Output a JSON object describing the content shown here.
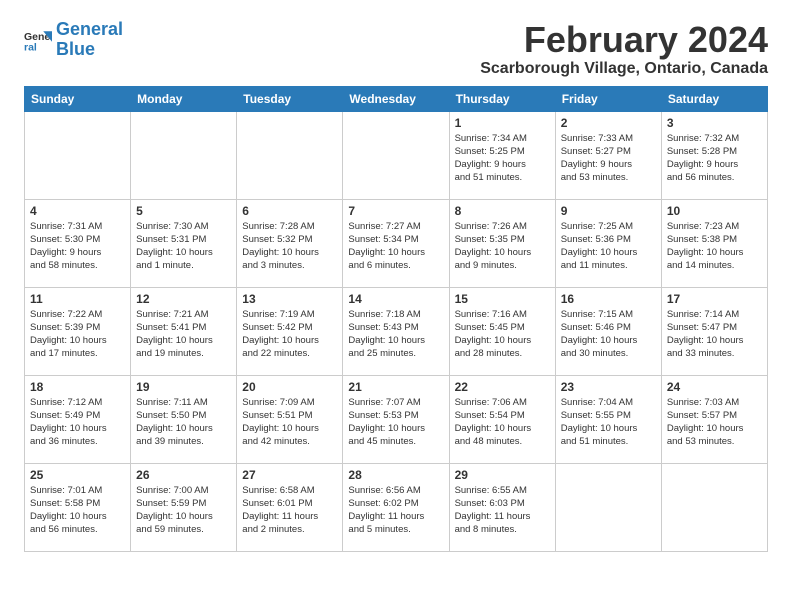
{
  "header": {
    "logo_line1": "General",
    "logo_line2": "Blue",
    "title": "February 2024",
    "subtitle": "Scarborough Village, Ontario, Canada"
  },
  "weekdays": [
    "Sunday",
    "Monday",
    "Tuesday",
    "Wednesday",
    "Thursday",
    "Friday",
    "Saturday"
  ],
  "weeks": [
    [
      {
        "day": "",
        "info": ""
      },
      {
        "day": "",
        "info": ""
      },
      {
        "day": "",
        "info": ""
      },
      {
        "day": "",
        "info": ""
      },
      {
        "day": "1",
        "info": "Sunrise: 7:34 AM\nSunset: 5:25 PM\nDaylight: 9 hours\nand 51 minutes."
      },
      {
        "day": "2",
        "info": "Sunrise: 7:33 AM\nSunset: 5:27 PM\nDaylight: 9 hours\nand 53 minutes."
      },
      {
        "day": "3",
        "info": "Sunrise: 7:32 AM\nSunset: 5:28 PM\nDaylight: 9 hours\nand 56 minutes."
      }
    ],
    [
      {
        "day": "4",
        "info": "Sunrise: 7:31 AM\nSunset: 5:30 PM\nDaylight: 9 hours\nand 58 minutes."
      },
      {
        "day": "5",
        "info": "Sunrise: 7:30 AM\nSunset: 5:31 PM\nDaylight: 10 hours\nand 1 minute."
      },
      {
        "day": "6",
        "info": "Sunrise: 7:28 AM\nSunset: 5:32 PM\nDaylight: 10 hours\nand 3 minutes."
      },
      {
        "day": "7",
        "info": "Sunrise: 7:27 AM\nSunset: 5:34 PM\nDaylight: 10 hours\nand 6 minutes."
      },
      {
        "day": "8",
        "info": "Sunrise: 7:26 AM\nSunset: 5:35 PM\nDaylight: 10 hours\nand 9 minutes."
      },
      {
        "day": "9",
        "info": "Sunrise: 7:25 AM\nSunset: 5:36 PM\nDaylight: 10 hours\nand 11 minutes."
      },
      {
        "day": "10",
        "info": "Sunrise: 7:23 AM\nSunset: 5:38 PM\nDaylight: 10 hours\nand 14 minutes."
      }
    ],
    [
      {
        "day": "11",
        "info": "Sunrise: 7:22 AM\nSunset: 5:39 PM\nDaylight: 10 hours\nand 17 minutes."
      },
      {
        "day": "12",
        "info": "Sunrise: 7:21 AM\nSunset: 5:41 PM\nDaylight: 10 hours\nand 19 minutes."
      },
      {
        "day": "13",
        "info": "Sunrise: 7:19 AM\nSunset: 5:42 PM\nDaylight: 10 hours\nand 22 minutes."
      },
      {
        "day": "14",
        "info": "Sunrise: 7:18 AM\nSunset: 5:43 PM\nDaylight: 10 hours\nand 25 minutes."
      },
      {
        "day": "15",
        "info": "Sunrise: 7:16 AM\nSunset: 5:45 PM\nDaylight: 10 hours\nand 28 minutes."
      },
      {
        "day": "16",
        "info": "Sunrise: 7:15 AM\nSunset: 5:46 PM\nDaylight: 10 hours\nand 30 minutes."
      },
      {
        "day": "17",
        "info": "Sunrise: 7:14 AM\nSunset: 5:47 PM\nDaylight: 10 hours\nand 33 minutes."
      }
    ],
    [
      {
        "day": "18",
        "info": "Sunrise: 7:12 AM\nSunset: 5:49 PM\nDaylight: 10 hours\nand 36 minutes."
      },
      {
        "day": "19",
        "info": "Sunrise: 7:11 AM\nSunset: 5:50 PM\nDaylight: 10 hours\nand 39 minutes."
      },
      {
        "day": "20",
        "info": "Sunrise: 7:09 AM\nSunset: 5:51 PM\nDaylight: 10 hours\nand 42 minutes."
      },
      {
        "day": "21",
        "info": "Sunrise: 7:07 AM\nSunset: 5:53 PM\nDaylight: 10 hours\nand 45 minutes."
      },
      {
        "day": "22",
        "info": "Sunrise: 7:06 AM\nSunset: 5:54 PM\nDaylight: 10 hours\nand 48 minutes."
      },
      {
        "day": "23",
        "info": "Sunrise: 7:04 AM\nSunset: 5:55 PM\nDaylight: 10 hours\nand 51 minutes."
      },
      {
        "day": "24",
        "info": "Sunrise: 7:03 AM\nSunset: 5:57 PM\nDaylight: 10 hours\nand 53 minutes."
      }
    ],
    [
      {
        "day": "25",
        "info": "Sunrise: 7:01 AM\nSunset: 5:58 PM\nDaylight: 10 hours\nand 56 minutes."
      },
      {
        "day": "26",
        "info": "Sunrise: 7:00 AM\nSunset: 5:59 PM\nDaylight: 10 hours\nand 59 minutes."
      },
      {
        "day": "27",
        "info": "Sunrise: 6:58 AM\nSunset: 6:01 PM\nDaylight: 11 hours\nand 2 minutes."
      },
      {
        "day": "28",
        "info": "Sunrise: 6:56 AM\nSunset: 6:02 PM\nDaylight: 11 hours\nand 5 minutes."
      },
      {
        "day": "29",
        "info": "Sunrise: 6:55 AM\nSunset: 6:03 PM\nDaylight: 11 hours\nand 8 minutes."
      },
      {
        "day": "",
        "info": ""
      },
      {
        "day": "",
        "info": ""
      }
    ]
  ]
}
